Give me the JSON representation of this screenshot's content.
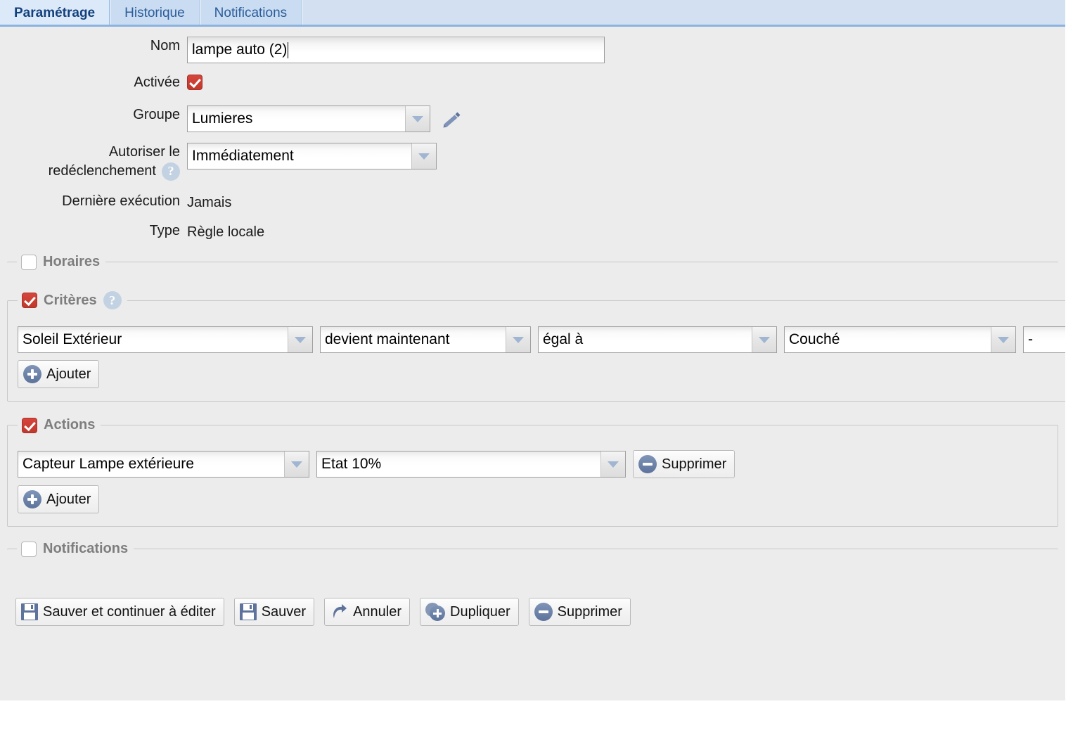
{
  "tabs": [
    {
      "label": "Paramétrage",
      "active": true
    },
    {
      "label": "Historique",
      "active": false
    },
    {
      "label": "Notifications",
      "active": false
    }
  ],
  "form": {
    "nom_label": "Nom",
    "nom_value": "lampe auto (2)",
    "activee_label": "Activée",
    "activee_checked": true,
    "groupe_label": "Groupe",
    "groupe_value": "Lumieres",
    "redeclenchement_label_line1": "Autoriser le",
    "redeclenchement_label_line2": "redéclenchement",
    "redeclenchement_value": "Immédiatement",
    "derniere_execution_label": "Dernière exécution",
    "derniere_execution_value": "Jamais",
    "type_label": "Type",
    "type_value": "Règle locale"
  },
  "sections": {
    "horaires": {
      "legend": "Horaires",
      "checked": false
    },
    "criteres": {
      "legend": "Critères",
      "checked": true,
      "rows": [
        {
          "source": "Soleil Extérieur",
          "event": "devient maintenant",
          "operator": "égal à",
          "value": "Couché",
          "extra": "-"
        }
      ],
      "add_label": "Ajouter"
    },
    "actions": {
      "legend": "Actions",
      "checked": true,
      "rows": [
        {
          "target": "Capteur Lampe extérieure",
          "command": "Etat 10%",
          "delete_label": "Supprimer"
        }
      ],
      "add_label": "Ajouter"
    },
    "notifications": {
      "legend": "Notifications",
      "checked": false
    }
  },
  "footer": {
    "save_continue_label": "Sauver et continuer à éditer",
    "save_label": "Sauver",
    "cancel_label": "Annuler",
    "duplicate_label": "Dupliquer",
    "delete_label": "Supprimer"
  },
  "colors": {
    "accent_red": "#c0392b",
    "tab_active_bg": "#dbe9f9",
    "tab_text": "#2b5d9b",
    "icon_blue": "#5d739b",
    "page_bg": "#ececec"
  }
}
